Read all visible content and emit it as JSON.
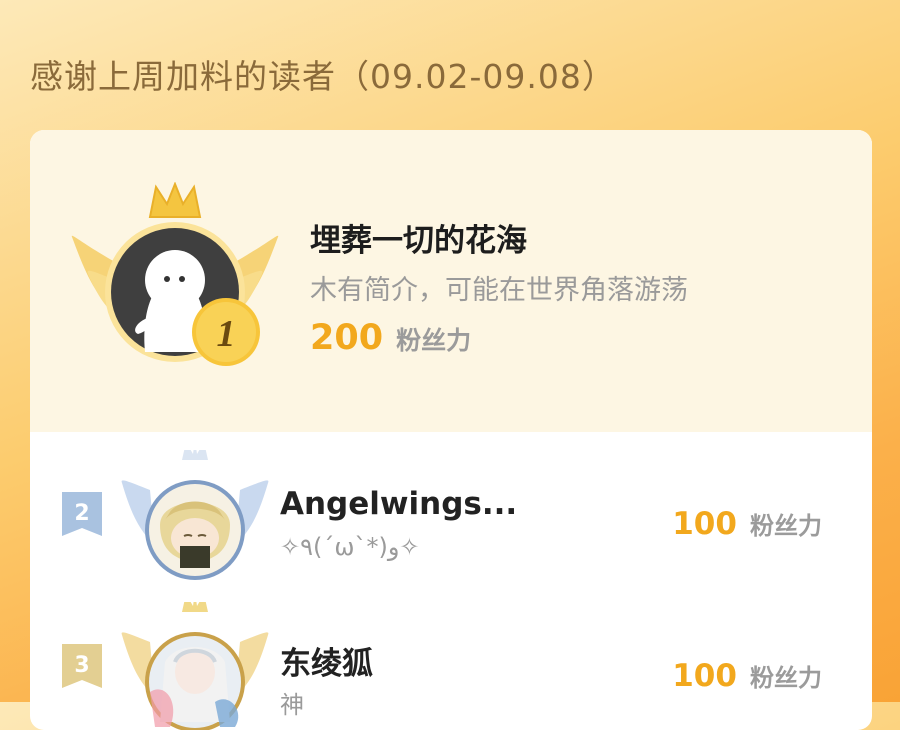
{
  "header": {
    "title": "感谢上周加料的读者（09.02-09.08）"
  },
  "leaderboard": {
    "unit": "粉丝力",
    "top": {
      "rank": "1",
      "name": "埋葬一切的花海",
      "bio": "木有简介，可能在世界角落游荡",
      "points": "200"
    },
    "rows": [
      {
        "rank": "2",
        "name": "Angelwings...",
        "sub": "✧٩(ˊωˋ*)و✧",
        "points": "100"
      },
      {
        "rank": "3",
        "name": "东绫狐",
        "sub": "神",
        "points": "100"
      }
    ]
  },
  "colors": {
    "gold": "#f2a81d",
    "silver_ring": "#7f9cc4",
    "bronze_ring": "#c9a14a",
    "card_top_bg": "#fdf6e3"
  },
  "icons": [
    "crown-icon",
    "wings-icon",
    "rank-medal-icon",
    "rank-flag-icon"
  ]
}
